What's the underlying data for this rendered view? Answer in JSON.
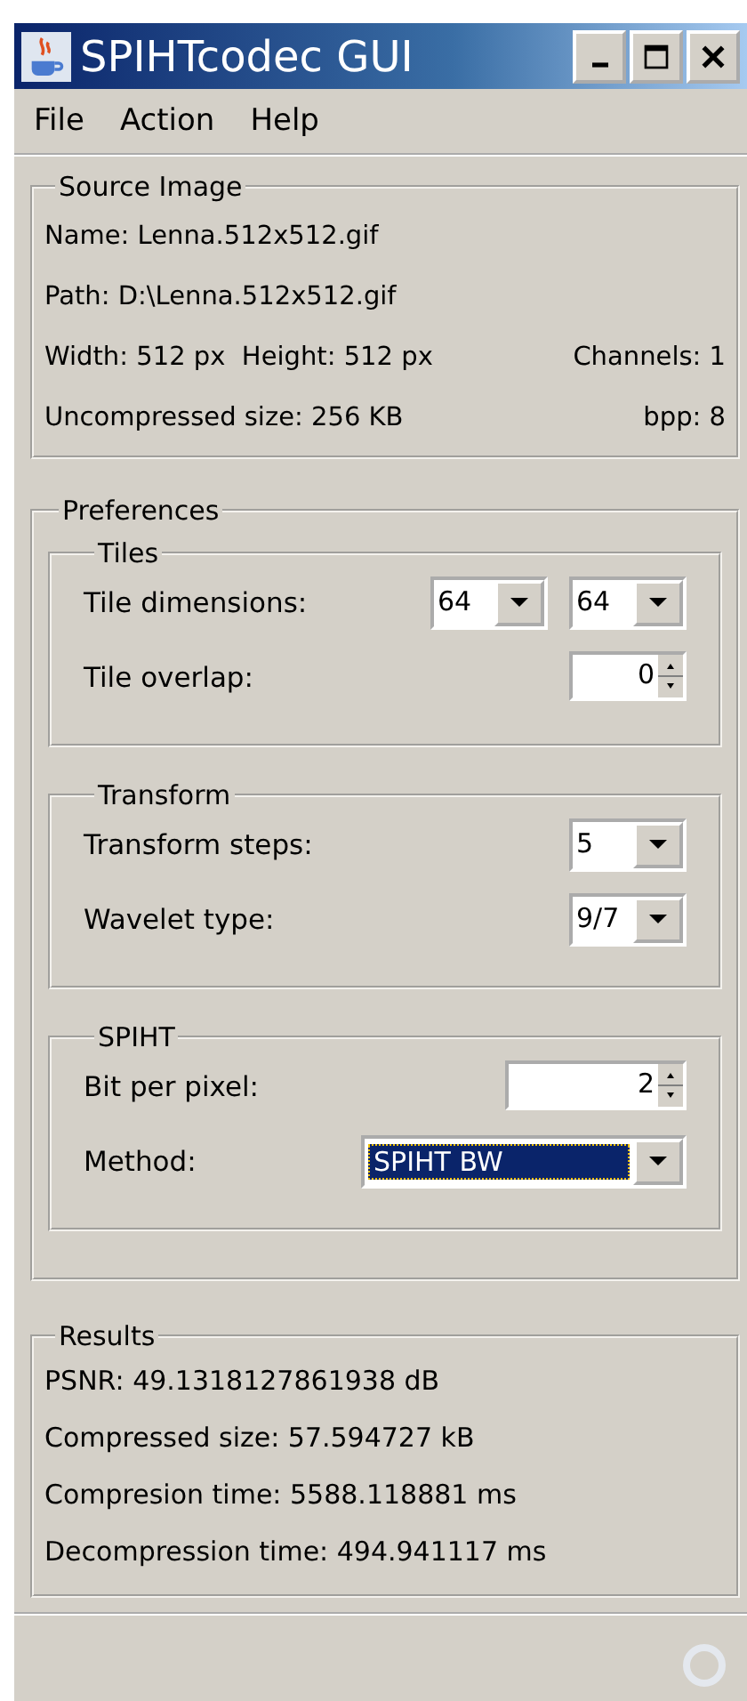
{
  "window": {
    "title": "SPIHTcodec GUI"
  },
  "menu": [
    "File",
    "Action",
    "Help"
  ],
  "source_image": {
    "title": "Source Image",
    "rows": [
      {
        "left": "Name: Lenna.512x512.gif"
      },
      {
        "left": "Path: D:\\Lenna.512x512.gif"
      },
      {
        "left": "Width: 512 px  Height: 512 px",
        "right": "Channels: 1"
      },
      {
        "left": "Uncompressed size: 256 KB",
        "right": "bpp: 8"
      }
    ]
  },
  "preferences": {
    "title": "Preferences",
    "groups": [
      {
        "title": "Tiles",
        "rows": [
          {
            "label": "Tile dimensions:",
            "controls": [
              {
                "kind": "combo",
                "value": "64",
                "focused": false
              },
              {
                "kind": "combo",
                "value": "64",
                "focused": false
              }
            ]
          },
          {
            "label": "Tile overlap:",
            "controls": [
              {
                "kind": "spinner",
                "value": "0"
              }
            ]
          }
        ]
      },
      {
        "title": "Transform",
        "rows": [
          {
            "label": "Transform steps:",
            "controls": [
              {
                "kind": "combo",
                "value": "5",
                "focused": false
              }
            ]
          },
          {
            "label": "Wavelet type:",
            "controls": [
              {
                "kind": "combo",
                "value": "9/7",
                "focused": false
              }
            ]
          }
        ]
      },
      {
        "title": "SPIHT",
        "rows": [
          {
            "label": "Bit per pixel:",
            "controls": [
              {
                "kind": "wide-spinner",
                "value": "2"
              }
            ]
          },
          {
            "label": "Method:",
            "controls": [
              {
                "kind": "wide-combo",
                "value": "SPIHT BW",
                "focused": true
              }
            ]
          }
        ]
      }
    ]
  },
  "results": {
    "title": "Results",
    "lines": [
      "PSNR: 49.1318127861938 dB",
      "Compressed size: 57.594727 kB",
      "Compresion time: 5588.118881 ms",
      "Decompression time: 494.941117 ms"
    ]
  }
}
